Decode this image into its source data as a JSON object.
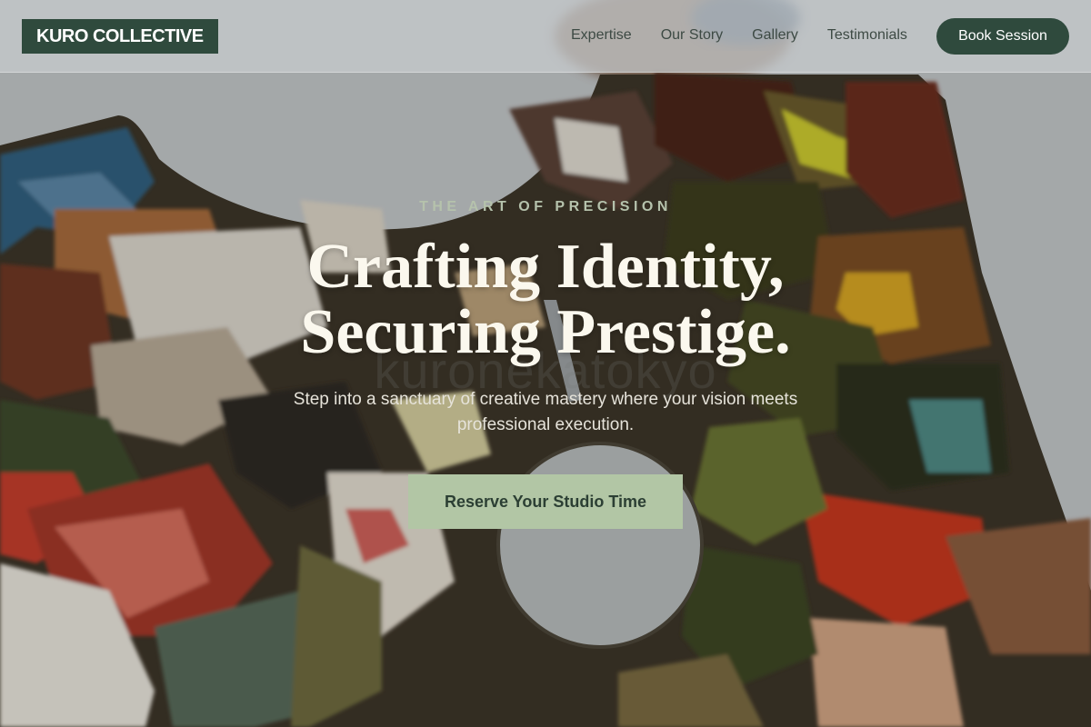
{
  "brand": {
    "logo_text": "KURO COLLECTIVE"
  },
  "nav": {
    "links": [
      {
        "label": "Expertise"
      },
      {
        "label": "Our Story"
      },
      {
        "label": "Gallery"
      },
      {
        "label": "Testimonials"
      }
    ],
    "cta_label": "Book Session"
  },
  "hero": {
    "eyebrow": "THE ART OF PRECISION",
    "headline_line1": "Crafting Identity,",
    "headline_line2": "Securing Prestige.",
    "subtext": "Step into a sanctuary of creative mastery where your vision meets professional execution.",
    "cta_label": "Reserve Your Studio Time",
    "watermark": "kuronekatokyo"
  },
  "colors": {
    "brand_green": "#2f4a3d",
    "cta_sage": "#b2c6a5",
    "eyebrow": "#b5c2ac",
    "headline": "#fbf8ee"
  }
}
